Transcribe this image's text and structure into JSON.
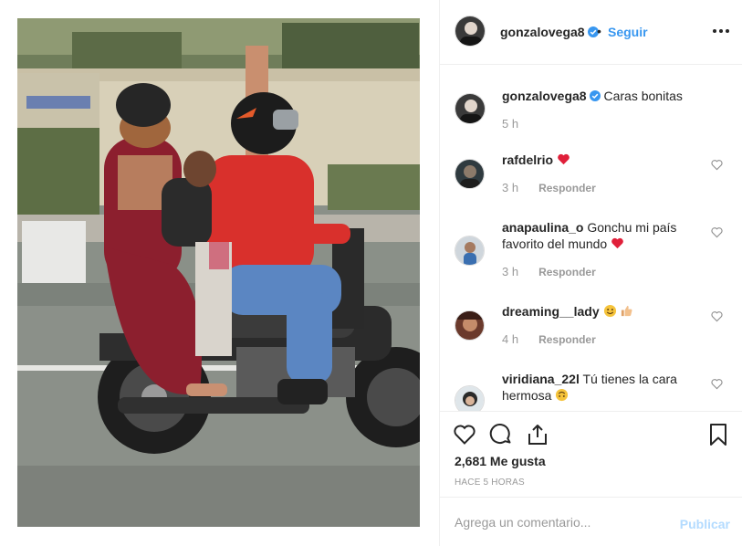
{
  "post": {
    "image_alt": "Familia en motocicleta",
    "author": "gonzalovega8",
    "verified": true,
    "follow_label": "Seguir",
    "separator": "•"
  },
  "caption": {
    "user": "gonzalovega8",
    "text": "Caras bonitas",
    "time": "5 h"
  },
  "comments": [
    {
      "user": "rafdelrio",
      "text": "",
      "emojis": [
        "heart-emoji"
      ],
      "time": "3 h",
      "reply_label": "Responder"
    },
    {
      "user": "anapaulina_o",
      "text": "Gonchu mi país favorito del mundo",
      "emojis": [
        "heart-emoji"
      ],
      "time": "3 h",
      "reply_label": "Responder"
    },
    {
      "user": "dreaming__lady",
      "text": "",
      "emojis": [
        "smile-emoji",
        "thumbs-up-emoji"
      ],
      "time": "4 h",
      "reply_label": "Responder"
    },
    {
      "user": "viridiana_22l",
      "text": "Tú tienes la cara hermosa",
      "emojis": [
        "upside-down-face-emoji"
      ]
    }
  ],
  "actions": {
    "likes": "2,681 Me gusta",
    "timestamp": "Hace 5 horas",
    "icons": [
      "heart-icon",
      "comment-icon",
      "share-icon",
      "bookmark-icon"
    ]
  },
  "add_comment": {
    "placeholder": "Agrega un comentario...",
    "publish_label": "Publicar"
  },
  "colors": {
    "link_blue": "#3897f0",
    "publish_disabled": "#b3dbff",
    "muted_text": "#999999",
    "heart_red": "#ed4956",
    "border": "#efefef"
  }
}
